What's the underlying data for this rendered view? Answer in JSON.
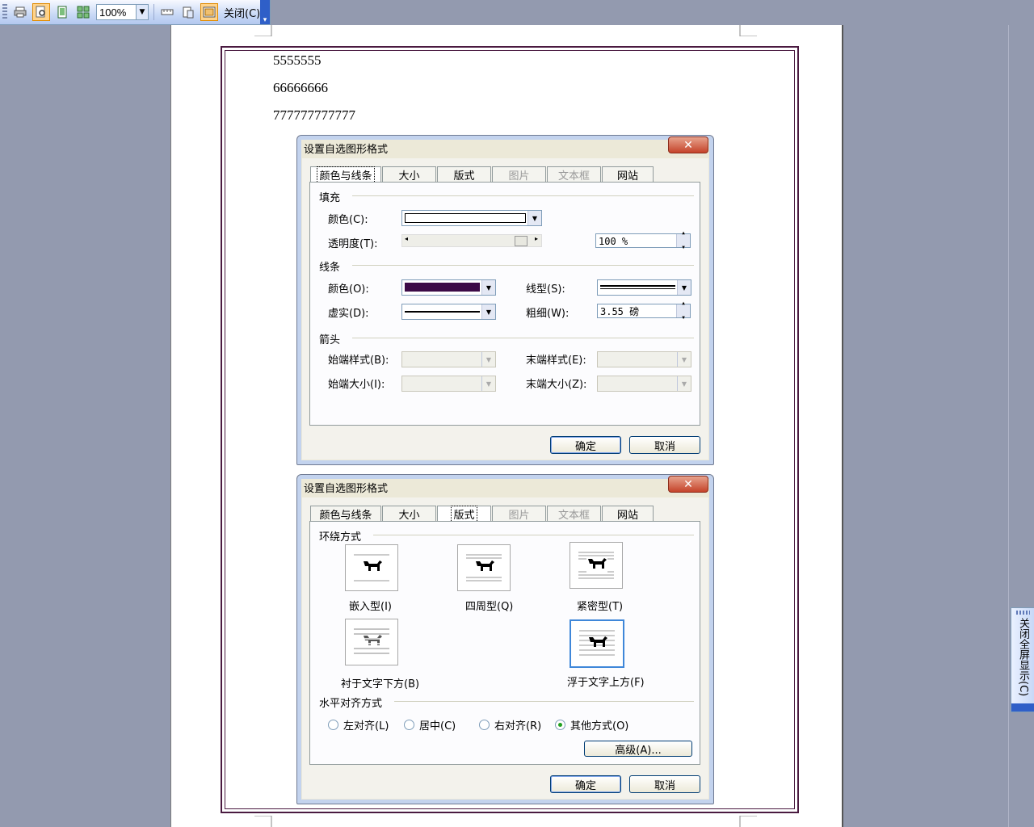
{
  "toolbar": {
    "zoom_value": "100%",
    "close_label": "关闭(C)"
  },
  "document": {
    "lines": [
      "5555555",
      "66666666",
      "777777777777"
    ],
    "fullscreen_close_label": "关闭全屏显示(C)"
  },
  "dialog1": {
    "title": "设置自选图形格式",
    "close_glyph": "✕",
    "tabs": [
      "颜色与线条",
      "大小",
      "版式",
      "图片",
      "文本框",
      "网站"
    ],
    "fill_group": "填充",
    "fill_color_label": "颜色(C):",
    "transparency_label": "透明度(T):",
    "transparency_value": "100 %",
    "line_group": "线条",
    "line_color_label": "颜色(O):",
    "line_style_label": "线型(S):",
    "dash_label": "虚实(D):",
    "weight_label": "粗细(W):",
    "weight_value": "3.55 磅",
    "arrow_group": "箭头",
    "begin_style_label": "始端样式(B):",
    "end_style_label": "末端样式(E):",
    "begin_size_label": "始端大小(I):",
    "end_size_label": "末端大小(Z):",
    "ok_label": "确定",
    "cancel_label": "取消",
    "line_color_hex": "#3c0a46"
  },
  "dialog2": {
    "title": "设置自选图形格式",
    "close_glyph": "✕",
    "tabs": [
      "颜色与线条",
      "大小",
      "版式",
      "图片",
      "文本框",
      "网站"
    ],
    "wrap_group": "环绕方式",
    "wrap_options": [
      "嵌入型(I)",
      "四周型(Q)",
      "紧密型(T)",
      "衬于文字下方(B)",
      "浮于文字上方(F)"
    ],
    "align_group": "水平对齐方式",
    "align_options": [
      "左对齐(L)",
      "居中(C)",
      "右对齐(R)",
      "其他方式(O)"
    ],
    "advanced_label": "高级(A)...",
    "ok_label": "确定",
    "cancel_label": "取消"
  }
}
